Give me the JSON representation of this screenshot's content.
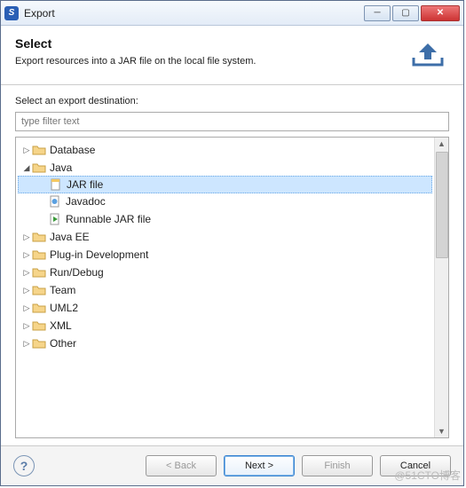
{
  "window": {
    "title": "Export"
  },
  "banner": {
    "heading": "Select",
    "subheading": "Export resources into a JAR file on the local file system."
  },
  "content": {
    "dest_label": "Select an export destination:",
    "filter_placeholder": "type filter text"
  },
  "tree": [
    {
      "label": "Database",
      "expanded": false,
      "depth": 0,
      "type": "folder"
    },
    {
      "label": "Java",
      "expanded": true,
      "depth": 0,
      "type": "folder"
    },
    {
      "label": "JAR file",
      "depth": 1,
      "type": "jar",
      "selected": true
    },
    {
      "label": "Javadoc",
      "depth": 1,
      "type": "javadoc"
    },
    {
      "label": "Runnable JAR file",
      "depth": 1,
      "type": "runjar"
    },
    {
      "label": "Java EE",
      "expanded": false,
      "depth": 0,
      "type": "folder"
    },
    {
      "label": "Plug-in Development",
      "expanded": false,
      "depth": 0,
      "type": "folder"
    },
    {
      "label": "Run/Debug",
      "expanded": false,
      "depth": 0,
      "type": "folder"
    },
    {
      "label": "Team",
      "expanded": false,
      "depth": 0,
      "type": "folder"
    },
    {
      "label": "UML2",
      "expanded": false,
      "depth": 0,
      "type": "folder"
    },
    {
      "label": "XML",
      "expanded": false,
      "depth": 0,
      "type": "folder"
    },
    {
      "label": "Other",
      "expanded": false,
      "depth": 0,
      "type": "folder"
    }
  ],
  "buttons": {
    "back": "< Back",
    "next": "Next >",
    "finish": "Finish",
    "cancel": "Cancel"
  },
  "watermark": "@51CTO博客"
}
